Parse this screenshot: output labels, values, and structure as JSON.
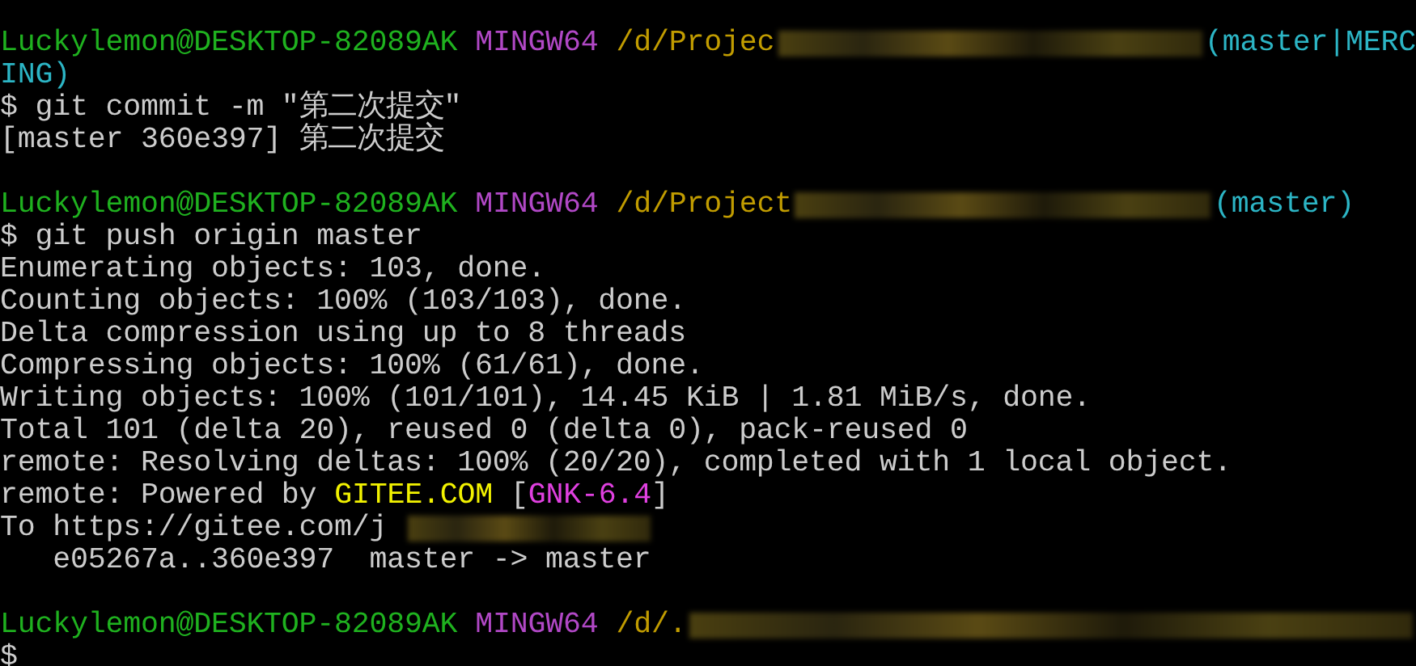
{
  "lines": [
    {
      "kind": "prompt",
      "user": "Luckylemon@DESKTOP-82089AK",
      "system": "MINGW64",
      "path": "/d/Projec",
      "branch": "(master|MERC"
    },
    {
      "kind": "output",
      "segments": [
        {
          "text": "ING)",
          "color": "#2cb5c5"
        }
      ]
    },
    {
      "kind": "output",
      "segments": [
        {
          "text": "$ git commit -m \"第二次提交\"",
          "color": "#cccccc"
        }
      ]
    },
    {
      "kind": "output",
      "segments": [
        {
          "text": "[master 360e397] 第二次提交",
          "color": "#cccccc"
        }
      ]
    },
    {
      "kind": "blank"
    },
    {
      "kind": "prompt",
      "user": "Luckylemon@DESKTOP-82089AK",
      "system": "MINGW64",
      "path": "/d/Project",
      "branch": "(master)"
    },
    {
      "kind": "output",
      "segments": [
        {
          "text": "$ git push origin master",
          "color": "#cccccc"
        }
      ]
    },
    {
      "kind": "output",
      "segments": [
        {
          "text": "Enumerating objects: 103, done.",
          "color": "#cccccc"
        }
      ]
    },
    {
      "kind": "output",
      "segments": [
        {
          "text": "Counting objects: 100% (103/103), done.",
          "color": "#cccccc"
        }
      ]
    },
    {
      "kind": "output",
      "segments": [
        {
          "text": "Delta compression using up to 8 threads",
          "color": "#cccccc"
        }
      ]
    },
    {
      "kind": "output",
      "segments": [
        {
          "text": "Compressing objects: 100% (61/61), done.",
          "color": "#cccccc"
        }
      ]
    },
    {
      "kind": "output",
      "segments": [
        {
          "text": "Writing objects: 100% (101/101), 14.45 KiB | 1.81 MiB/s, done.",
          "color": "#cccccc"
        }
      ]
    },
    {
      "kind": "output",
      "segments": [
        {
          "text": "Total 101 (delta 20), reused 0 (delta 0), pack-reused 0",
          "color": "#cccccc"
        }
      ]
    },
    {
      "kind": "output",
      "segments": [
        {
          "text": "remote: Resolving deltas: 100% (20/20), completed with 1 local object.",
          "color": "#cccccc"
        }
      ]
    },
    {
      "kind": "output",
      "segments": [
        {
          "text": "remote: Powered by",
          "color": "#cccccc"
        },
        {
          "text": "GITEE.COM",
          "color": "#f2f200"
        },
        {
          "text": "[",
          "color": "#cccccc"
        },
        {
          "text": "GNK-6.4",
          "color": "#e040e0"
        },
        {
          "text": "]",
          "color": "#cccccc"
        }
      ]
    },
    {
      "kind": "output",
      "segments": [
        {
          "text": "To https://gitee.com/j",
          "color": "#cccccc"
        },
        {
          "kind": "redacted"
        }
      ]
    },
    {
      "kind": "output",
      "segments": [
        {
          "text": "   e05267a..360e397  master -> master",
          "color": "#cccccc"
        }
      ]
    },
    {
      "kind": "blank"
    },
    {
      "kind": "prompt",
      "user": "Luckylemon@DESKTOP-82089AK",
      "system": "MINGW64",
      "path": "/d/."
    },
    {
      "kind": "output",
      "segments": [
        {
          "text": "$",
          "color": "#cccccc"
        }
      ]
    }
  ]
}
